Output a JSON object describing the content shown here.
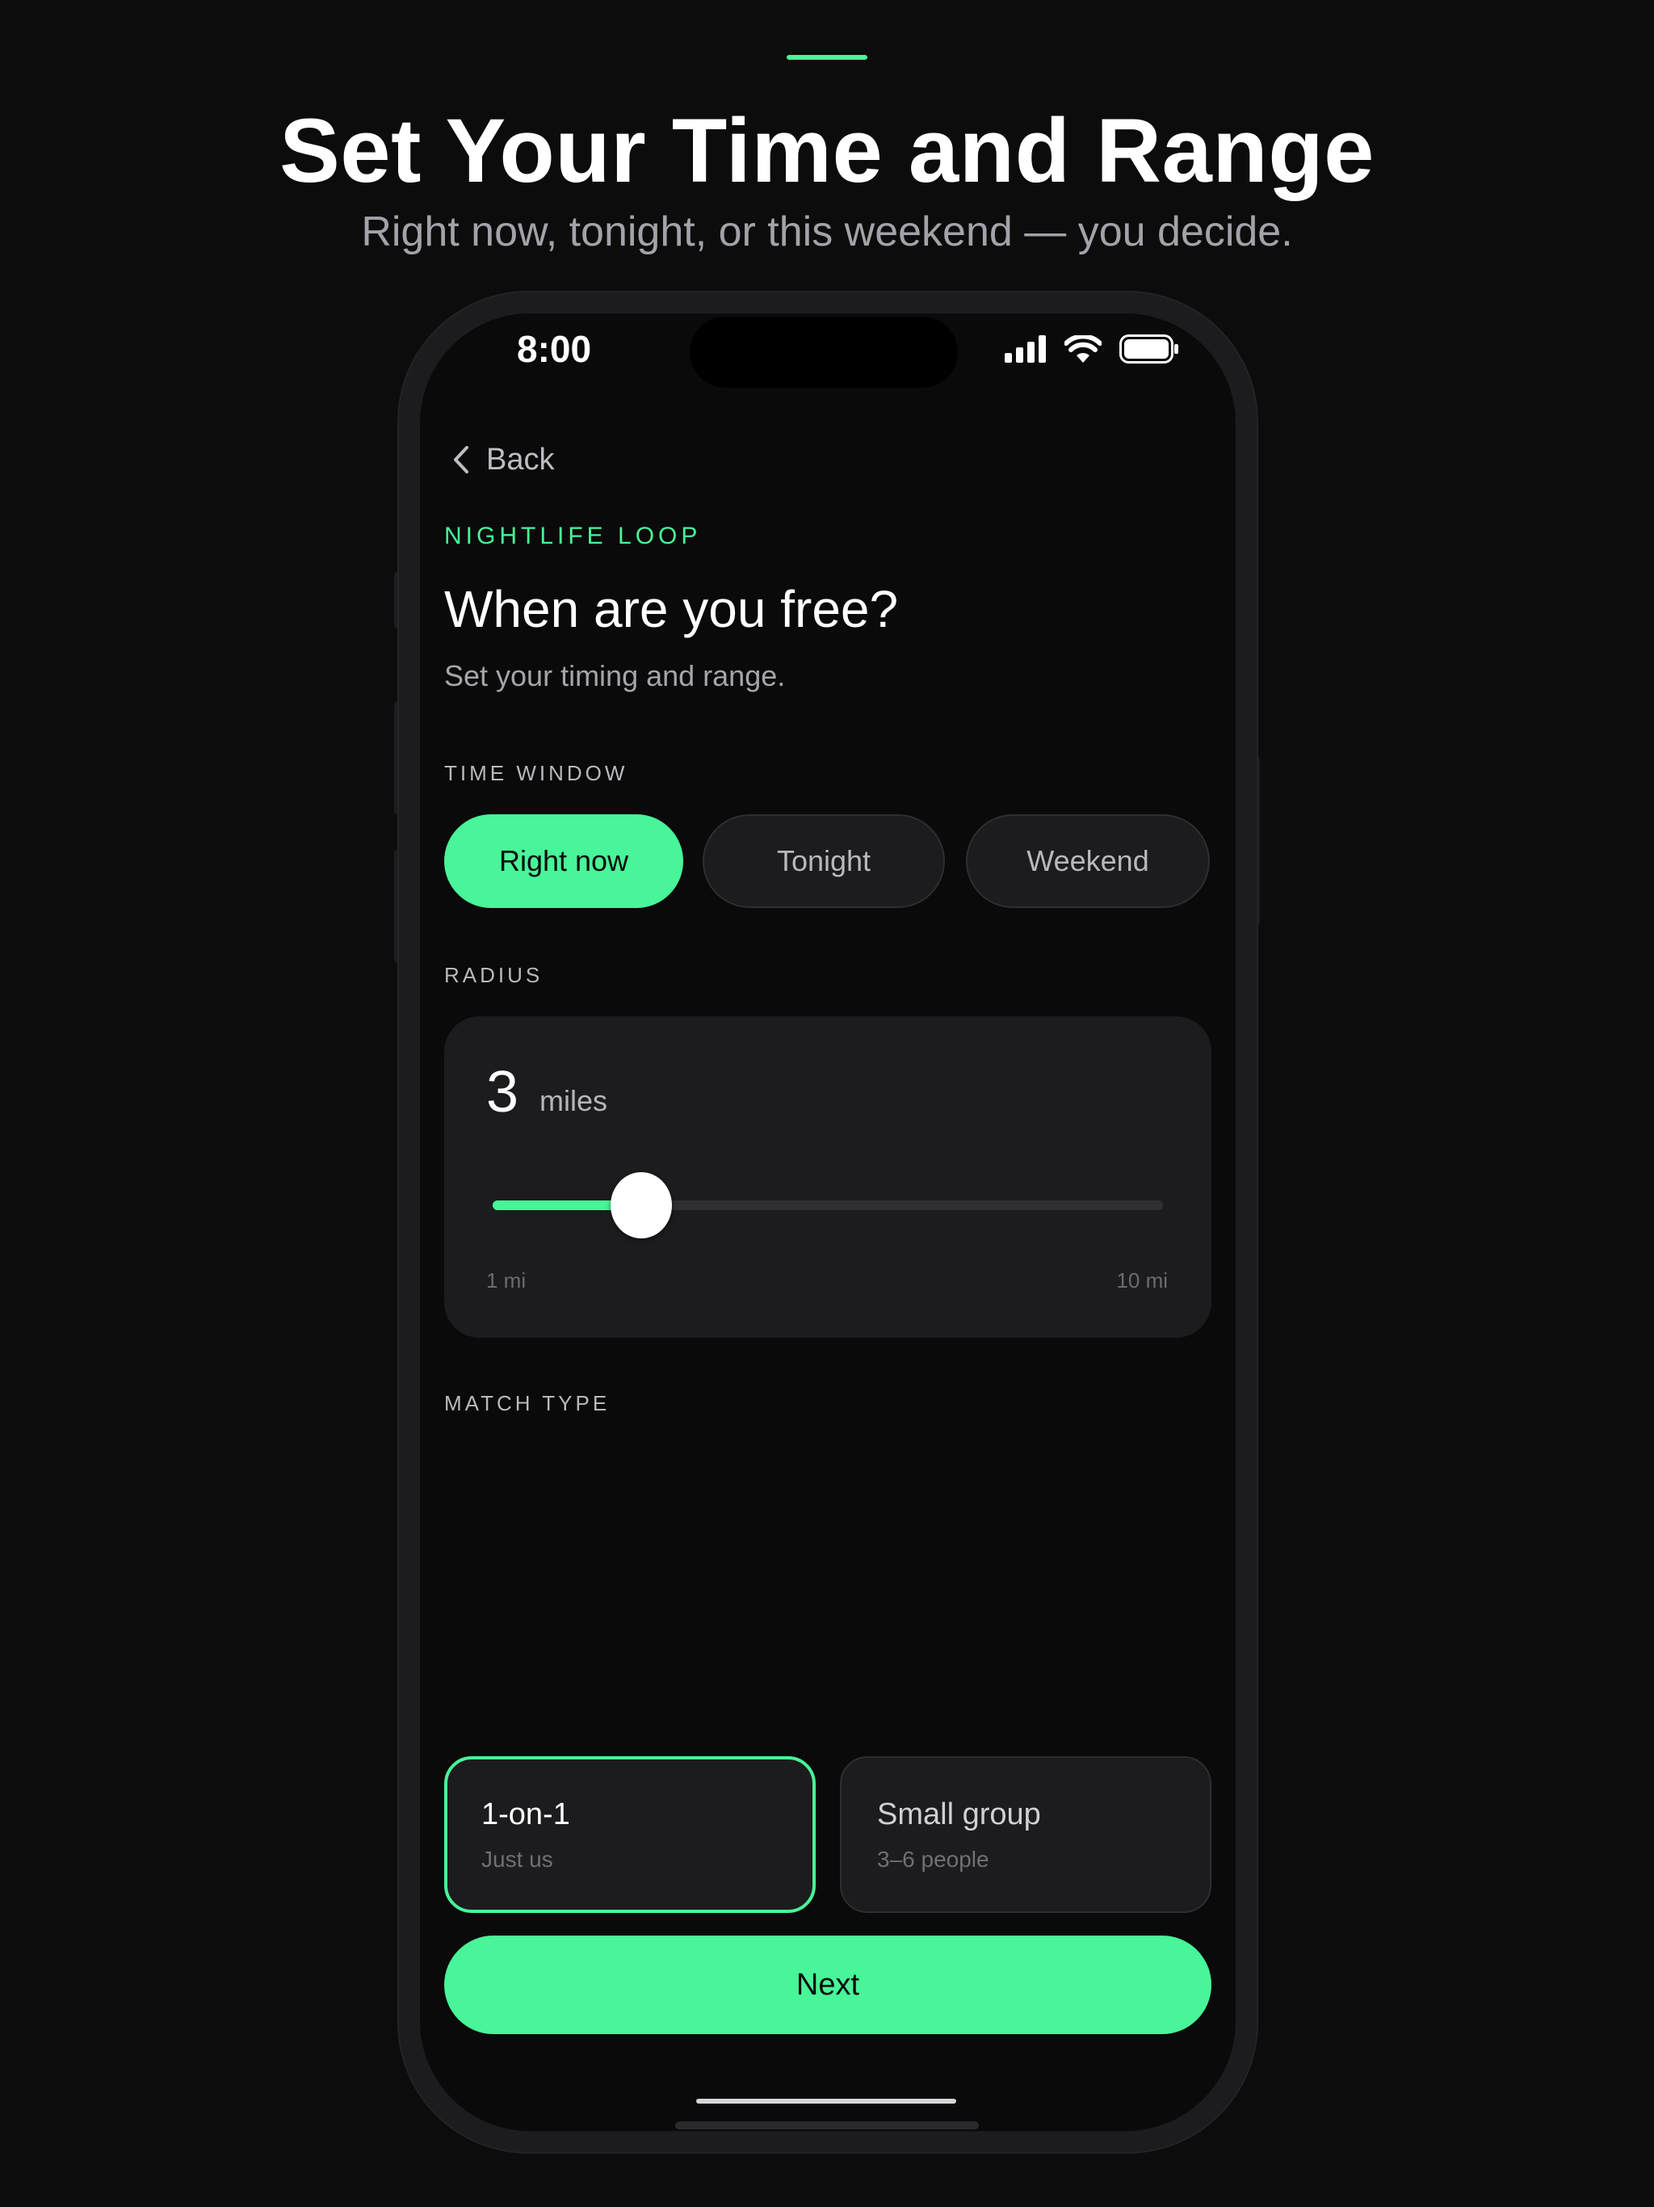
{
  "promo": {
    "title": "Set Your Time and Range",
    "subtitle": "Right now, tonight, or this weekend — you decide."
  },
  "status_bar": {
    "time": "8:00",
    "icons": [
      "signal-icon",
      "wifi-icon",
      "battery-icon"
    ]
  },
  "nav": {
    "back_label": "Back"
  },
  "header": {
    "eyebrow": "NIGHTLIFE LOOP",
    "title": "When are you free?",
    "subtitle": "Set your timing and range."
  },
  "time_window": {
    "label": "TIME WINDOW",
    "options": [
      {
        "label": "Right now",
        "selected": true
      },
      {
        "label": "Tonight",
        "selected": false
      },
      {
        "label": "Weekend",
        "selected": false
      }
    ]
  },
  "radius": {
    "label": "RADIUS",
    "value": "3",
    "unit": "miles",
    "min_label": "1 mi",
    "max_label": "10 mi",
    "min": 1,
    "max": 10,
    "current": 3
  },
  "match_type": {
    "label": "MATCH TYPE",
    "options": [
      {
        "title": "1-on-1",
        "subtitle": "Just us",
        "selected": true
      },
      {
        "title": "Small group",
        "subtitle": "3–6 people",
        "selected": false
      }
    ]
  },
  "footer": {
    "next_label": "Next"
  },
  "colors": {
    "accent": "#48f598",
    "background": "#0c0c0c",
    "card": "#1c1c1e"
  }
}
